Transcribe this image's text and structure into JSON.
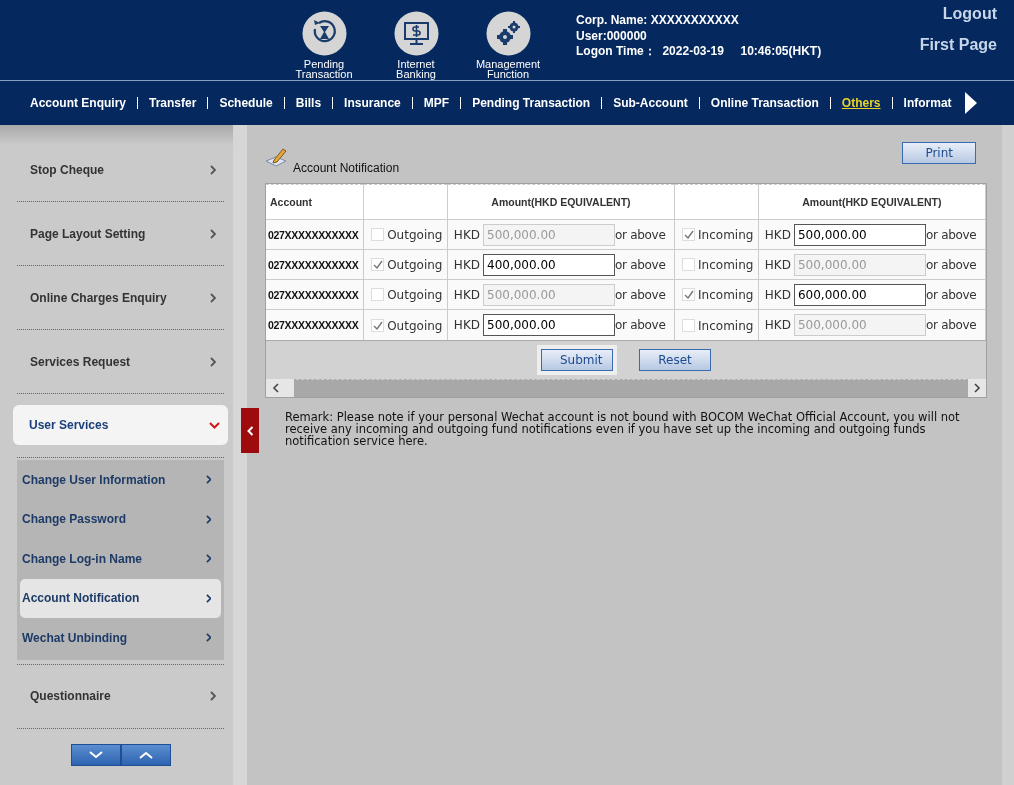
{
  "header": {
    "shortcuts": [
      {
        "kind": "pending",
        "label": "Pending Transaction"
      },
      {
        "kind": "banking",
        "label": "Internet Banking"
      },
      {
        "kind": "management",
        "label": "Management Function"
      }
    ],
    "user_info": [
      "Corp. Name: XXXXXXXXXXX",
      "User:000000",
      "Logon Time：  2022-03-19     10:46:05(HKT)"
    ],
    "links": [
      "Logout",
      "First Page"
    ]
  },
  "nav": [
    {
      "label": "Account Enquiry",
      "selected": false
    },
    {
      "label": "Transfer",
      "selected": false
    },
    {
      "label": "Schedule",
      "selected": false
    },
    {
      "label": "Bills",
      "selected": false
    },
    {
      "label": "Insurance",
      "selected": false
    },
    {
      "label": "MPF",
      "selected": false
    },
    {
      "label": "Pending Transaction",
      "selected": false
    },
    {
      "label": "Sub-Account",
      "selected": false
    },
    {
      "label": "Online Transaction",
      "selected": false
    },
    {
      "label": "Others",
      "selected": true
    },
    {
      "label": "Informat",
      "selected": false
    }
  ],
  "sidebar": {
    "items": [
      {
        "label": "Stop Cheque",
        "expanded": false
      },
      {
        "label": "Page Layout Setting",
        "expanded": false
      },
      {
        "label": "Online Charges Enquiry",
        "expanded": false
      },
      {
        "label": "Services Request",
        "expanded": false
      },
      {
        "label": "User Services",
        "expanded": true,
        "children": [
          {
            "label": "Change User Information",
            "selected": false
          },
          {
            "label": "Change Password",
            "selected": false
          },
          {
            "label": "Change Log-in Name",
            "selected": false
          },
          {
            "label": "Account Notification",
            "selected": true
          },
          {
            "label": "Wechat Unbinding",
            "selected": false
          }
        ]
      },
      {
        "label": "Questionnaire",
        "expanded": false
      }
    ]
  },
  "content": {
    "title": "Account Notification",
    "print_button": "Print",
    "table": {
      "account_heading": "Account",
      "amount_headings": [
        "Amount(HKD EQUIVALENT)",
        "Amount(HKD EQUIVALENT)"
      ],
      "rows": [
        {
          "account": "027XXXXXXXXXXX",
          "outgoing": {
            "label": "Outgoing",
            "checked": false,
            "currency": "HKD",
            "amount": "500,000.00",
            "suffix": "or above"
          },
          "incoming": {
            "label": "Incoming",
            "checked": true,
            "currency": "HKD",
            "amount": "500,000.00",
            "suffix": "or above"
          }
        },
        {
          "account": "027XXXXXXXXXXX",
          "outgoing": {
            "label": "Outgoing",
            "checked": true,
            "currency": "HKD",
            "amount": "400,000.00",
            "suffix": "or above"
          },
          "incoming": {
            "label": "Incoming",
            "checked": false,
            "currency": "HKD",
            "amount": "500,000.00",
            "suffix": "or above"
          }
        },
        {
          "account": "027XXXXXXXXXXX",
          "outgoing": {
            "label": "Outgoing",
            "checked": false,
            "currency": "HKD",
            "amount": "500,000.00",
            "suffix": "or above"
          },
          "incoming": {
            "label": "Incoming",
            "checked": true,
            "currency": "HKD",
            "amount": "600,000.00",
            "suffix": "or above"
          }
        },
        {
          "account": "027XXXXXXXXXXX",
          "outgoing": {
            "label": "Outgoing",
            "checked": true,
            "currency": "HKD",
            "amount": "500,000.00",
            "suffix": "or above"
          },
          "incoming": {
            "label": "Incoming",
            "checked": false,
            "currency": "HKD",
            "amount": "500,000.00",
            "suffix": "or above"
          }
        }
      ]
    },
    "buttons": [
      {
        "label": "Submit",
        "focused": true
      },
      {
        "label": "Reset",
        "focused": false
      }
    ],
    "remark": "Remark: Please note if your personal Wechat account is not bound with BOCOM WeChat Official Account, you will not receive any incoming and outgoing fund notifications even if you have set up the incoming and outgoing funds notification service here."
  }
}
